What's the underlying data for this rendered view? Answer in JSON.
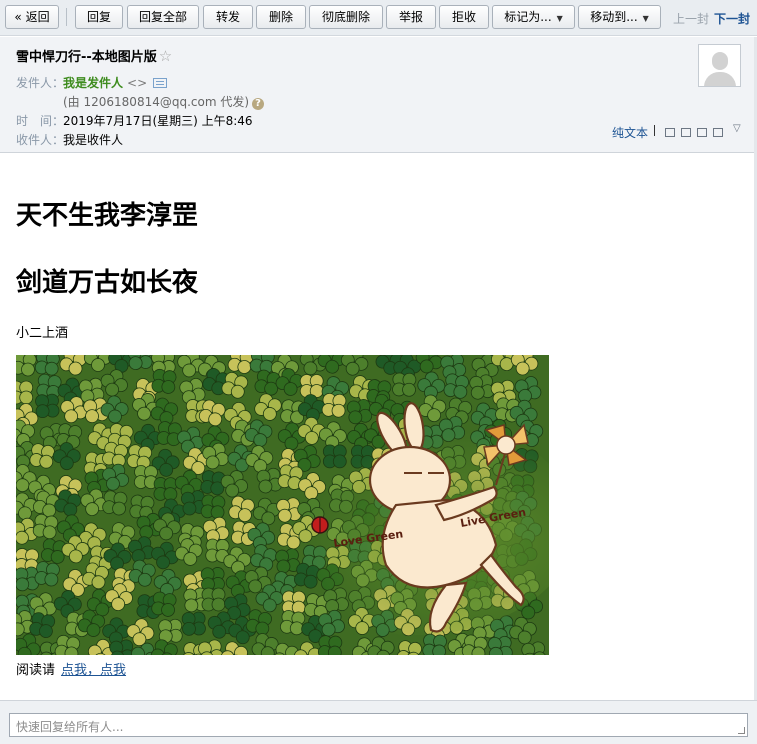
{
  "toolbar": {
    "back": "« 返回",
    "reply": "回复",
    "reply_all": "回复全部",
    "forward": "转发",
    "delete": "删除",
    "delete_permanent": "彻底删除",
    "report": "举报",
    "reject": "拒收",
    "mark_as": "标记为...",
    "move_to": "移动到...",
    "prev": "上一封",
    "next": "下一封"
  },
  "header": {
    "subject": "雪中悍刀行--本地图片版",
    "star": "☆",
    "from_label": "发件人：",
    "from_name": "我是发件人",
    "from_addr": "<>",
    "proxy": "(由 1206180814@qq.com 代发)",
    "time_label": "时　间：",
    "time": "2019年7月17日(星期三) 上午8:46",
    "to_label": "收件人：",
    "to_name": "我是收件人",
    "plaintext": "纯文本"
  },
  "body": {
    "line1": "天不生我李淳罡",
    "line2": "剑道万古如长夜",
    "line3": "小二上酒",
    "read_prefix": "阅读请",
    "read_link": "点我，点我"
  },
  "image": {
    "text_left": "Love Green",
    "text_right": "Live Green"
  },
  "reply_box": {
    "placeholder": "快速回复给所有人..."
  }
}
